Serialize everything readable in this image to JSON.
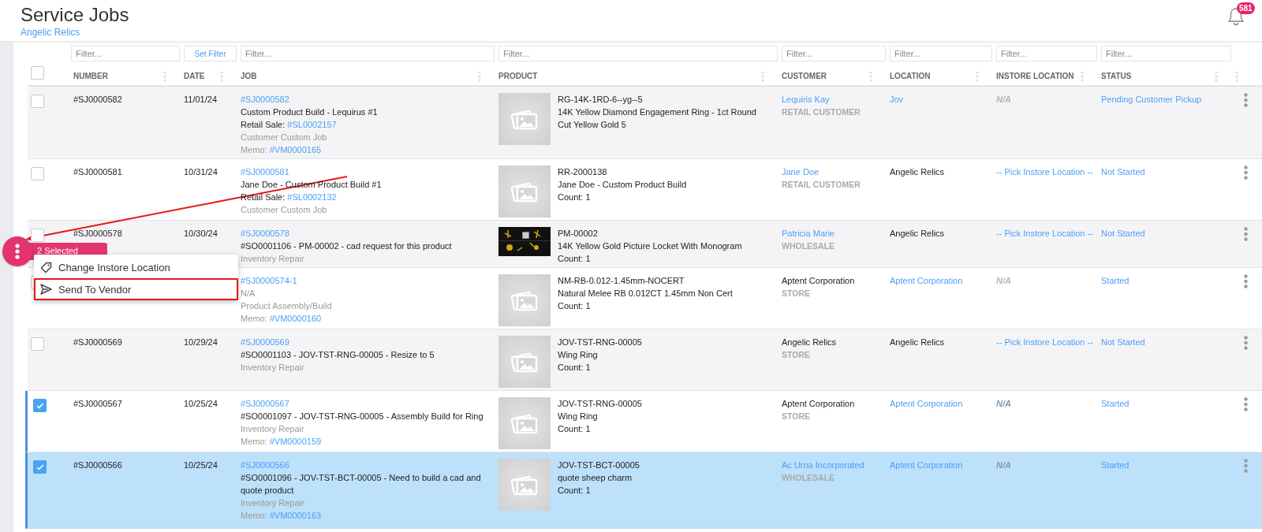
{
  "page": {
    "title": "Service Jobs",
    "subtitle": "Angelic Relics",
    "notifications": "581"
  },
  "filters": [
    {
      "kind": "input",
      "placeholder": "Filter..."
    },
    {
      "kind": "button",
      "text": "Set Filter"
    },
    {
      "kind": "input",
      "placeholder": "Filter..."
    },
    {
      "kind": "input",
      "placeholder": "Filter..."
    },
    {
      "kind": "input",
      "placeholder": "Filter..."
    },
    {
      "kind": "input",
      "placeholder": "Filter..."
    },
    {
      "kind": "input",
      "placeholder": "Filter..."
    },
    {
      "kind": "input",
      "placeholder": "Filter..."
    }
  ],
  "table": {
    "select_all": {
      "checked": false
    },
    "columns": [
      "NUMBER",
      "DATE",
      "JOB",
      "PRODUCT",
      "CUSTOMER",
      "LOCATION",
      "INSTORE LOCATION",
      "STATUS"
    ],
    "rows": [
      {
        "selected": false,
        "number": "#SJ0000582",
        "date": "11/01/24",
        "job": [
          {
            "kind": "link",
            "text": "#SJ0000582"
          },
          {
            "kind": "text",
            "text": "Custom Product Build - Lequirus #1"
          },
          {
            "kind": "sale",
            "label": "Retail Sale:",
            "link": "#SL0002157"
          },
          {
            "kind": "muted",
            "text": "Customer Custom Job"
          },
          {
            "kind": "memo",
            "label": "Memo:",
            "link": "#VM0000165"
          }
        ],
        "product": {
          "kind": "placeholder",
          "sku": "RG-14K-1RD-6--yg--5",
          "name": "14K Yellow Diamond Engagement Ring - 1ct Round Cut Yellow Gold 5"
        },
        "customer": {
          "name": "Lequiris Kay",
          "link": true,
          "type": "RETAIL CUSTOMER"
        },
        "location": {
          "text": "Jov",
          "link": true
        },
        "instore": {
          "kind": "na",
          "text": "N/A"
        },
        "status": "Pending Customer Pickup"
      },
      {
        "selected": false,
        "number": "#SJ0000581",
        "date": "10/31/24",
        "job": [
          {
            "kind": "link",
            "text": "#SJ0000581"
          },
          {
            "kind": "text",
            "text": "Jane Doe - Custom Product Build #1"
          },
          {
            "kind": "sale",
            "label": "Retail Sale:",
            "link": "#SL0002132"
          },
          {
            "kind": "muted",
            "text": "Customer Custom Job"
          }
        ],
        "product": {
          "kind": "placeholder",
          "sku": "RR-2000138",
          "name": "Jane Doe - Custom Product Build",
          "count": "Count: 1"
        },
        "customer": {
          "name": "Jane Doe",
          "link": true,
          "type": "RETAIL CUSTOMER"
        },
        "location": {
          "text": "Angelic Relics",
          "link": false
        },
        "instore": {
          "kind": "link",
          "text": "-- Pick Instore Location --"
        },
        "status": "Not Started"
      },
      {
        "selected": false,
        "number": "#SJ0000578",
        "date": "10/30/24",
        "job": [
          {
            "kind": "link",
            "text": "#SJ0000578"
          },
          {
            "kind": "text",
            "text": "#SO0001106 - PM-00002 - cad request for this product"
          },
          {
            "kind": "muted",
            "text": "Inventory Repair"
          }
        ],
        "product": {
          "kind": "picture",
          "sku": "PM-00002",
          "name": "14K Yellow Gold Picture Locket With Monogram",
          "count": "Count: 1"
        },
        "customer": {
          "name": "Patricia Marie",
          "link": true,
          "type": "WHOLESALE"
        },
        "location": {
          "text": "Angelic Relics",
          "link": false
        },
        "instore": {
          "kind": "link",
          "text": "-- Pick Instore Location --"
        },
        "status": "Not Started"
      },
      {
        "selected": false,
        "job": [
          {
            "kind": "link",
            "text": "#SJ0000574-1"
          },
          {
            "kind": "muted",
            "text": "N/A"
          },
          {
            "kind": "muted",
            "text": "Product Assembly/Build"
          },
          {
            "kind": "memo",
            "label": "Memo:",
            "link": "#VM0000160"
          }
        ],
        "product": {
          "kind": "placeholder",
          "sku": "NM-RB-0.012-1.45mm-NOCERT",
          "name": "Natural Melee RB 0.012CT 1.45mm Non Cert",
          "count": "Count: 1"
        },
        "customer": {
          "name": "Aptent Corporation",
          "link": false,
          "type": "STORE"
        },
        "location": {
          "text": "Aptent Corporation",
          "link": true
        },
        "instore": {
          "kind": "na",
          "text": "N/A"
        },
        "status": "Started"
      },
      {
        "selected": false,
        "number": "#SJ0000569",
        "date": "10/29/24",
        "job": [
          {
            "kind": "link",
            "text": "#SJ0000569"
          },
          {
            "kind": "text",
            "text": "#SO0001103 - JOV-TST-RNG-00005 - Resize to 5"
          },
          {
            "kind": "muted",
            "text": "Inventory Repair"
          }
        ],
        "product": {
          "kind": "placeholder",
          "sku": "JOV-TST-RNG-00005",
          "name": "Wing Ring",
          "count": "Count: 1"
        },
        "customer": {
          "name": "Angelic Relics",
          "link": false,
          "type": "STORE"
        },
        "location": {
          "text": "Angelic Relics",
          "link": false
        },
        "instore": {
          "kind": "link",
          "text": "-- Pick Instore Location --"
        },
        "status": "Not Started"
      },
      {
        "selected": true,
        "number": "#SJ0000567",
        "date": "10/25/24",
        "job": [
          {
            "kind": "link",
            "text": "#SJ0000567"
          },
          {
            "kind": "text",
            "text": "#SO0001097 - JOV-TST-RNG-00005 - Assembly Build for Ring"
          },
          {
            "kind": "muted",
            "text": "Inventory Repair"
          },
          {
            "kind": "memo",
            "label": "Memo:",
            "link": "#VM0000159"
          }
        ],
        "product": {
          "kind": "placeholder",
          "sku": "JOV-TST-RNG-00005",
          "name": "Wing Ring",
          "count": "Count: 1"
        },
        "customer": {
          "name": "Aptent Corporation",
          "link": false,
          "type": "STORE"
        },
        "location": {
          "text": "Aptent Corporation",
          "link": true
        },
        "instore": {
          "kind": "na",
          "text": "N/A"
        },
        "status": "Started"
      },
      {
        "selected": true,
        "number": "#SJ0000566",
        "date": "10/25/24",
        "job": [
          {
            "kind": "link",
            "text": "#SJ0000566"
          },
          {
            "kind": "text",
            "text": "#SO0001096 - JOV-TST-BCT-00005 - Need to build a cad and quote product"
          },
          {
            "kind": "muted",
            "text": "Inventory Repair"
          },
          {
            "kind": "memo",
            "label": "Memo:",
            "link": "#VM0000163"
          }
        ],
        "product": {
          "kind": "placeholder",
          "sku": "JOV-TST-BCT-00005",
          "name": "quote sheep charm",
          "count": "Count: 1"
        },
        "customer": {
          "name": "Ac Urna Incorporated",
          "link": true,
          "type": "WHOLESALE"
        },
        "location": {
          "text": "Aptent Corporation",
          "link": true
        },
        "instore": {
          "kind": "na",
          "text": "N/A"
        },
        "status": "Started"
      }
    ]
  },
  "bulk_actions": {
    "selection": "2 Selected",
    "items": [
      {
        "kind": "tag",
        "label": "Change Instore Location",
        "highlighted": false
      },
      {
        "kind": "send",
        "label": "Send To Vendor",
        "highlighted": true
      }
    ]
  }
}
